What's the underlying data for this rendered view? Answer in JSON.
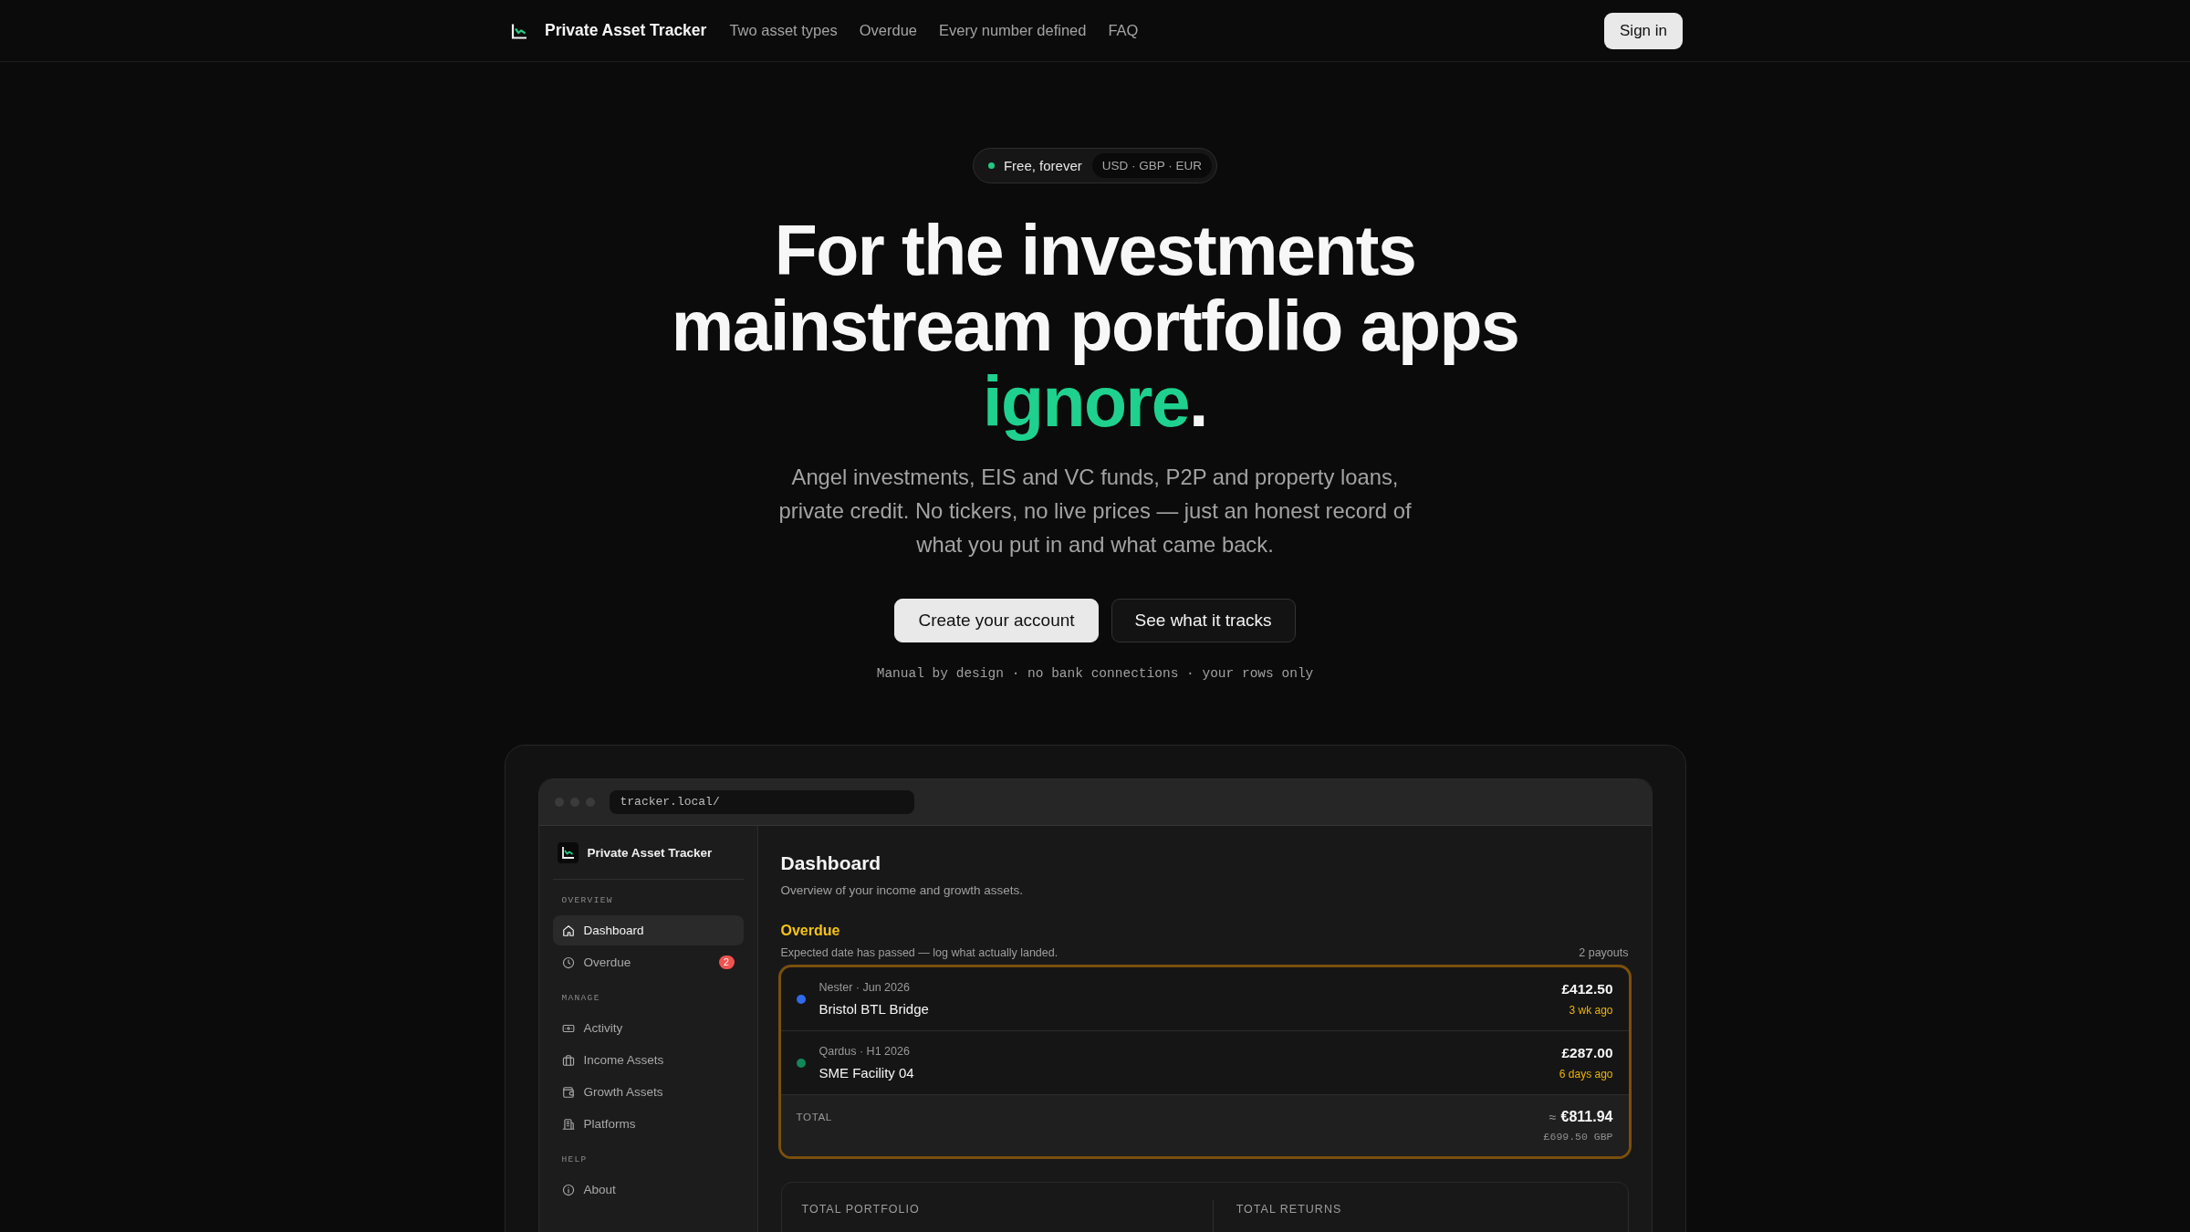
{
  "nav": {
    "brand": "Private Asset Tracker",
    "links": [
      "Two asset types",
      "Overdue",
      "Every number defined",
      "FAQ"
    ],
    "sign_in": "Sign in"
  },
  "hero": {
    "badge": {
      "label": "Free, forever",
      "currencies": "USD · GBP · EUR"
    },
    "headline": {
      "text": "For the investments mainstream portfolio apps",
      "highlight": "ignore",
      "end_mark": "."
    },
    "lead": "Angel investments, EIS and VC funds, P2P and property loans, private credit. No tickers, no live prices — just an honest record of what you put in and what came back.",
    "buttons": [
      {
        "label": "Create your account",
        "kind": "primary"
      },
      {
        "label": "See what it tracks",
        "kind": "secondary"
      }
    ],
    "note": "Manual by design · no bank connections · your rows only"
  },
  "app_preview": {
    "url": "tracker.local/",
    "sidebar": {
      "brand": "Private Asset Tracker",
      "sections": [
        {
          "heading": "OVERVIEW",
          "items": [
            {
              "label": "Dashboard",
              "selected": true
            },
            {
              "label": "Overdue",
              "selected": false,
              "badge": "2"
            }
          ]
        },
        {
          "heading": "MANAGE",
          "items": [
            {
              "label": "Activity",
              "selected": false
            },
            {
              "label": "Income Assets",
              "selected": false
            },
            {
              "label": "Growth Assets",
              "selected": false
            },
            {
              "label": "Platforms",
              "selected": false
            }
          ]
        },
        {
          "heading": "HELP",
          "items": [
            {
              "label": "About",
              "selected": false
            }
          ]
        }
      ]
    },
    "main": {
      "title": "Dashboard",
      "subtitle": "Overview of your income and growth assets.",
      "overdue": {
        "title": "Overdue",
        "description": "Expected date has passed — log what actually landed.",
        "count": "2 payouts",
        "rows": [
          {
            "meta": "Nester · Jun 2026",
            "name": "Bristol BTL Bridge",
            "amount": "£412.50",
            "age": "3 wk ago",
            "color": "#2f6be8"
          },
          {
            "meta": "Qardus · H1 2026",
            "name": "SME Facility 04",
            "amount": "£287.00",
            "age": "6 days ago",
            "color": "#12875a"
          }
        ],
        "total": {
          "label": "TOTAL",
          "approx": "≈",
          "value": "€811.94",
          "converted": "£699.50 GBP"
        }
      },
      "stats": [
        {
          "label": "TOTAL PORTFOLIO"
        },
        {
          "label": "TOTAL RETURNS"
        }
      ]
    }
  }
}
